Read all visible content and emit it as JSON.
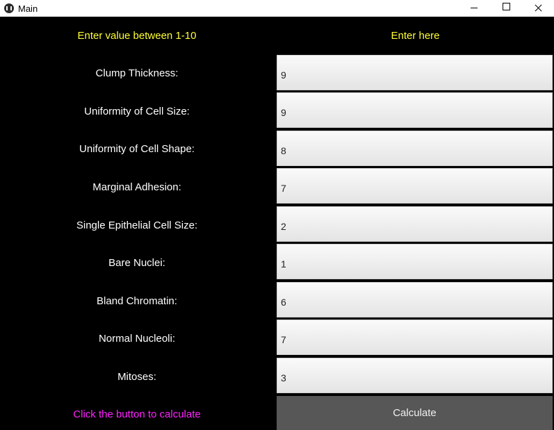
{
  "window": {
    "title": "Main"
  },
  "header": {
    "left": "Enter value between 1-10",
    "right": "Enter here"
  },
  "rows": [
    {
      "label": "Clump Thickness:",
      "value": "9"
    },
    {
      "label": "Uniformity of Cell Size:",
      "value": "9"
    },
    {
      "label": "Uniformity of Cell Shape:",
      "value": "8"
    },
    {
      "label": "Marginal Adhesion:",
      "value": "7"
    },
    {
      "label": "Single Epithelial Cell Size:",
      "value": "2"
    },
    {
      "label": "Bare Nuclei:",
      "value": "1"
    },
    {
      "label": "Bland Chromatin:",
      "value": "6"
    },
    {
      "label": "Normal Nucleoli:",
      "value": "7"
    },
    {
      "label": "Mitoses:",
      "value": "3"
    }
  ],
  "footer": {
    "hint": "Click the button to calculate",
    "button_label": "Calculate"
  },
  "colors": {
    "background": "#000000",
    "header_text": "#ffff33",
    "hint_text": "#ff22ff",
    "button": "#575757"
  }
}
